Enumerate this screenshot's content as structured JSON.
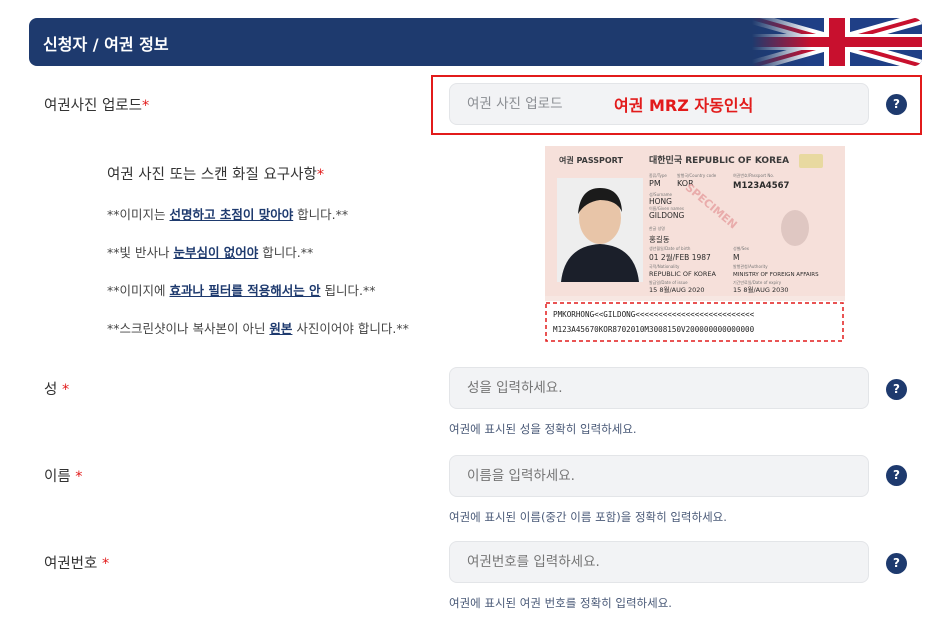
{
  "header": {
    "title": "신청자 / 여권 정보"
  },
  "photo_upload": {
    "label": "여권사진 업로드",
    "required_mark": "*",
    "field_placeholder": "여권 사진 업로드",
    "mrz_label": "여권 MRZ 자동인식",
    "help": "?"
  },
  "requirements": {
    "title": "여권 사진 또는 스캔 화질 요구사항",
    "required_mark": "*",
    "items": [
      {
        "pre": "**이미지는 ",
        "emph": "선명하고 초점이 맞아야",
        "post": " 합니다.**"
      },
      {
        "pre": "**빛 반사나 ",
        "emph": "눈부심이 없어야",
        "post": " 합니다.**"
      },
      {
        "pre": "**이미지에 ",
        "emph": "효과나 필터를 적용해서는 안",
        "post": " 됩니다.**"
      },
      {
        "pre": "**스크린샷이나 복사본이 아닌 ",
        "emph": "원본",
        "post": " 사진이어야 합니다.**"
      }
    ]
  },
  "passport_sample": {
    "header_left": "여권 PASSPORT",
    "header_right": "대한민국 REPUBLIC OF KOREA",
    "type_label": "종류/Type",
    "type": "PM",
    "country_label": "발행국/Country code",
    "country": "KOR",
    "passport_no_label": "여권번호/Passport No.",
    "passport_no": "M123A4567",
    "surname_label": "성/Surname",
    "surname": "HONG",
    "given_label": "이름/Given names",
    "given": "GILDONG",
    "korean_label": "한글 성명",
    "korean_name": "홍길동",
    "dob_label": "생년월일/Date of birth",
    "dob": "01 2월/FEB 1987",
    "sex_label": "성별/Sex",
    "sex": "M",
    "nationality_label": "국적/Nationality",
    "nationality": "REPUBLIC OF KOREA",
    "authority_label": "발행관청/Authority",
    "authority": "MINISTRY OF FOREIGN AFFAIRS",
    "issue_label": "발급일/Date of issue",
    "issue": "15 8월/AUG 2020",
    "expiry_label": "기간만료일/Date of expiry",
    "expiry": "15 8월/AUG 2030",
    "specimen": "SPECIMEN",
    "mrz_line1": "PMKORHONG<<GILDONG<<<<<<<<<<<<<<<<<<<<<<<<<<",
    "mrz_line2": "M123A45670KOR8702010M3008150V200000000000000"
  },
  "surname": {
    "label": "성",
    "required_mark": "*",
    "placeholder": "성을 입력하세요.",
    "hint": "여권에 표시된 성을 정확히 입력하세요.",
    "help": "?"
  },
  "given_name": {
    "label": "이름",
    "required_mark": "*",
    "placeholder": "이름을 입력하세요.",
    "hint": "여권에 표시된 이름(중간 이름 포함)을 정확히 입력하세요.",
    "help": "?"
  },
  "passport_number": {
    "label": "여권번호",
    "required_mark": "*",
    "placeholder": "여권번호를 입력하세요.",
    "hint": "여권에 표시된 여권 번호를 정확히 입력하세요.",
    "help": "?"
  },
  "colors": {
    "navy": "#1e3a6e",
    "red": "#e21b1b"
  }
}
